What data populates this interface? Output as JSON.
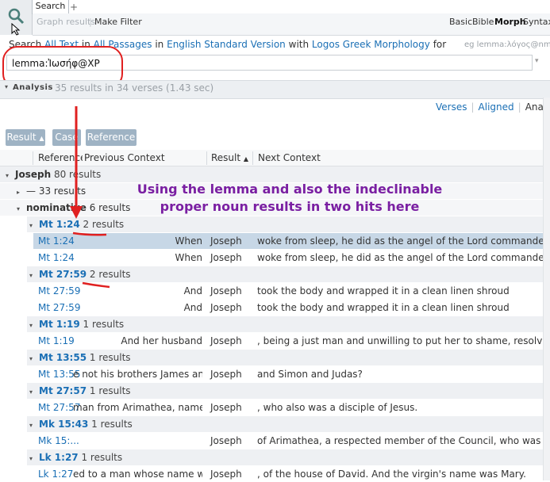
{
  "tabs": {
    "search": "Search",
    "add": "+"
  },
  "toolbar": {
    "graph_results": "Graph results",
    "make_filter": "Make Filter",
    "basic": "Basic",
    "bible": "Bible",
    "morph": "Morph",
    "syntax": "Syntax"
  },
  "search_line": {
    "w1": "Search",
    "all_text": "All Text",
    "w2": "in",
    "all_passages": "All Passages",
    "w3": "in",
    "version": "English Standard Version",
    "w4": "with",
    "morph": "Logos Greek Morphology",
    "w5": "for"
  },
  "eg_hint": "eg lemma:λόγος@nmsa",
  "query": "lemma:Ἰωσήφ@XP",
  "analysis": {
    "label": "Analysis",
    "stats": "35 results in 34 verses (1.43 sec)"
  },
  "views": {
    "verses": "Verses",
    "aligned": "Aligned",
    "analysis": "Analysis"
  },
  "pills": {
    "result": "Result",
    "case": "Case",
    "reference": "Reference"
  },
  "columns": {
    "reference": "Reference",
    "previous": "Previous Context",
    "result": "Result",
    "next": "Next Context"
  },
  "tree": {
    "joseph": "Joseph",
    "joseph_count": "80 results",
    "dash": "—",
    "dash_count": "33 results",
    "nominative": "nominative",
    "nominative_count": "6 results"
  },
  "groups": [
    {
      "ref": "Mt 1:24",
      "count": "2 results",
      "rows": [
        {
          "ref": "Mt 1:24",
          "prev": "When",
          "res": "Joseph",
          "next": "woke from sleep, he did as the angel of the Lord commanded him: h"
        },
        {
          "ref": "Mt 1:24",
          "prev": "When",
          "res": "Joseph",
          "next": "woke from sleep, he did as the angel of the Lord commanded him: h"
        }
      ]
    },
    {
      "ref": "Mt 27:59",
      "count": "2 results",
      "rows": [
        {
          "ref": "Mt 27:59",
          "prev": "And",
          "res": "Joseph",
          "next": "took the body and wrapped it in a clean linen shroud"
        },
        {
          "ref": "Mt 27:59",
          "prev": "And",
          "res": "Joseph",
          "next": "took the body and wrapped it in a clean linen shroud"
        }
      ]
    },
    {
      "ref": "Mt 1:19",
      "count": "1 results",
      "rows": [
        {
          "ref": "Mt 1:19",
          "prev": "And her husband",
          "res": "Joseph",
          "next": ", being a just man and unwilling to put her to shame, resolved to divo"
        }
      ]
    },
    {
      "ref": "Mt 13:55",
      "count": "1 results",
      "rows": [
        {
          "ref": "Mt 13:55",
          "prev": "e not his brothers James and",
          "res": "Joseph",
          "next": "and Simon and Judas?"
        }
      ]
    },
    {
      "ref": "Mt 27:57",
      "count": "1 results",
      "rows": [
        {
          "ref": "Mt 27:57",
          "prev": "man from Arimathea, named",
          "res": "Joseph",
          "next": ", who also was a disciple of Jesus."
        }
      ]
    },
    {
      "ref": "Mk 15:43",
      "count": "1 results",
      "rows": [
        {
          "ref": "Mk 15:...",
          "prev": "",
          "res": "Joseph",
          "next": "of Arimathea, a respected member of the Council, who was also him"
        }
      ]
    },
    {
      "ref": "Lk 1:27",
      "count": "1 results",
      "rows": [
        {
          "ref": "Lk 1:27",
          "prev": "ed to a man whose name was",
          "res": "Joseph",
          "next": ", of the house of David. And the virgin's name was Mary."
        }
      ]
    }
  ],
  "annotation": {
    "line1": "Using the lemma and also the indeclinable",
    "line2": "proper noun results in two hits here"
  },
  "colors": {
    "link": "#1a6fb5",
    "annotation": "#7a1fa2",
    "marker": "#e02020",
    "selected_row": "#c7d7e6"
  }
}
